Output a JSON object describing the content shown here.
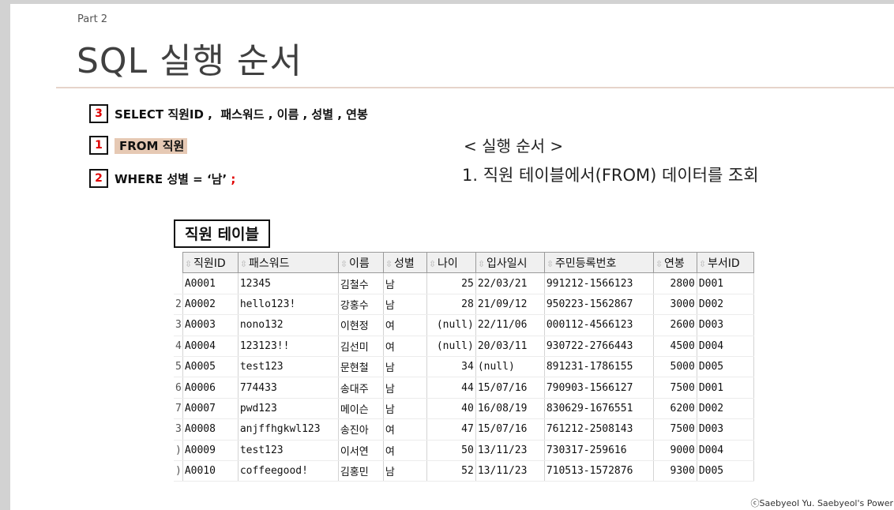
{
  "slide": {
    "part_label": "Part 2",
    "title": "SQL 실행 순서"
  },
  "steps": [
    {
      "num": "3",
      "text": "SELECT 직원ID ,  패스워드 , 이름 , 성별 , 연봉",
      "suffix": ""
    },
    {
      "num": "1",
      "text": "FROM 직원",
      "suffix": ""
    },
    {
      "num": "2",
      "text": "WHERE 성별 = ‘남’ ",
      "suffix": ";"
    }
  ],
  "execution_order": {
    "title": "< 실행 순서 >",
    "step1": "1. 직원 테이블에서(FROM) 데이터를 조회"
  },
  "table": {
    "title": "직원 테이블",
    "sort_icon": "sort-arrows-icon",
    "columns": [
      "직원ID",
      "패스워드",
      "이름",
      "성별",
      "나이",
      "입사일시",
      "주민등록번호",
      "연봉",
      "부서ID"
    ],
    "row_numbers": [
      "",
      "2",
      "3",
      "4",
      "5",
      "6",
      "7",
      "3",
      ")",
      ")"
    ],
    "rows": [
      [
        "A0001",
        "12345",
        "김철수",
        "남",
        "25",
        "22/03/21",
        "991212-1566123",
        "2800",
        "D001"
      ],
      [
        "A0002",
        "hello123!",
        "강홍수",
        "남",
        "28",
        "21/09/12",
        "950223-1562867",
        "3000",
        "D002"
      ],
      [
        "A0003",
        "nono132",
        "이현정",
        "여",
        "(null)",
        "22/11/06",
        "000112-4566123",
        "2600",
        "D003"
      ],
      [
        "A0004",
        "123123!!",
        "김선미",
        "여",
        "(null)",
        "20/03/11",
        "930722-2766443",
        "4500",
        "D004"
      ],
      [
        "A0005",
        "test123",
        "문현철",
        "남",
        "34",
        "(null)",
        "891231-1786155",
        "5000",
        "D005"
      ],
      [
        "A0006",
        "774433",
        "송대주",
        "남",
        "44",
        "15/07/16",
        "790903-1566127",
        "7500",
        "D001"
      ],
      [
        "A0007",
        "pwd123",
        "메이슨",
        "남",
        "40",
        "16/08/19",
        "830629-1676551",
        "6200",
        "D002"
      ],
      [
        "A0008",
        "anjffhgkwl123",
        "송진아",
        "여",
        "47",
        "15/07/16",
        "761212-2508143",
        "7500",
        "D003"
      ],
      [
        "A0009",
        "test123",
        "이서연",
        "여",
        "50",
        "13/11/23",
        "730317-259616",
        "9000",
        "D004"
      ],
      [
        "A0010",
        "coffeegood!",
        "김홍민",
        "남",
        "52",
        "13/11/23",
        "710513-1572876",
        "9300",
        "D005"
      ]
    ]
  },
  "footer": {
    "copyright": "ⓒSaebyeol Yu. Saebyeol's Power"
  },
  "colors": {
    "accent_red": "#e00000",
    "highlight": "#e6c9b4",
    "rule": "#e6d4ca"
  }
}
